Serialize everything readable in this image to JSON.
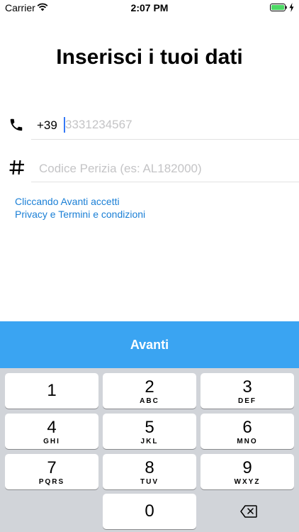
{
  "status_bar": {
    "carrier": "Carrier",
    "time": "2:07 PM",
    "icons": [
      "wifi-icon",
      "battery-icon",
      "charging-icon"
    ]
  },
  "form": {
    "title": "Inserisci i tuoi dati",
    "phone": {
      "icon": "phone-icon",
      "prefix": "+39",
      "value": "",
      "placeholder": "3331234567"
    },
    "code": {
      "icon": "hash-icon",
      "value": "",
      "placeholder": "Codice Perizia (es: AL182000)"
    },
    "terms": {
      "line1": "Cliccando Avanti accetti",
      "line2": "Privacy e Termini e condizioni"
    },
    "next_label": "Avanti"
  },
  "colors": {
    "accent": "#3aa4f2",
    "link": "#1a7fd6",
    "caret": "#3478f6",
    "keyboard_bg": "#d1d4d9"
  },
  "keyboard": {
    "keys": [
      {
        "num": "1",
        "letters": ""
      },
      {
        "num": "2",
        "letters": "ABC"
      },
      {
        "num": "3",
        "letters": "DEF"
      },
      {
        "num": "4",
        "letters": "GHI"
      },
      {
        "num": "5",
        "letters": "JKL"
      },
      {
        "num": "6",
        "letters": "MNO"
      },
      {
        "num": "7",
        "letters": "PQRS"
      },
      {
        "num": "8",
        "letters": "TUV"
      },
      {
        "num": "9",
        "letters": "WXYZ"
      },
      {
        "num": "0",
        "letters": ""
      }
    ],
    "delete_icon": "backspace-icon"
  }
}
